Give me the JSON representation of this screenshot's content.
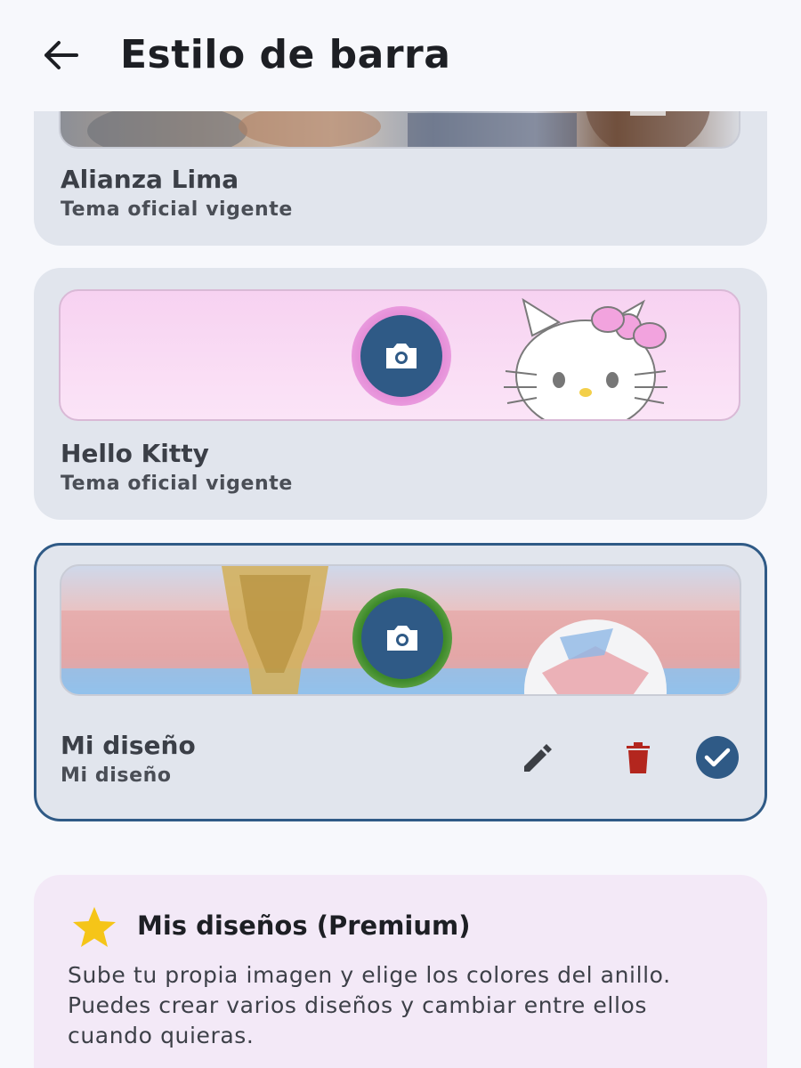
{
  "header": {
    "title": "Estilo de barra",
    "back_icon": "arrow-back-icon"
  },
  "cards": [
    {
      "name": "Alianza Lima",
      "subtitle": "Tema oficial vigente",
      "selected": false
    },
    {
      "name": "Hello Kitty",
      "subtitle": "Tema oficial vigente",
      "selected": false,
      "ring_color": "#e58fd8",
      "camera_icon": "camera-icon"
    },
    {
      "name": "Mi diseño",
      "subtitle": "Mi diseño",
      "selected": true,
      "ring_color": "#3e8a2a",
      "camera_icon": "camera-icon",
      "actions": [
        "edit-icon",
        "delete-icon",
        "check-circle-icon"
      ]
    }
  ],
  "premium": {
    "icon": "star-icon",
    "title": "Mis diseños (Premium)",
    "description_lines": [
      "Sube tu propia imagen y elige los colores del anillo.",
      "Puedes crear varios diseños y cambiar entre ellos",
      "cuando quieras."
    ]
  },
  "colors": {
    "accent": "#2f5a86",
    "delete": "#b3261e",
    "star": "#f5c518",
    "card_bg": "#e1e5ed",
    "premium_bg": "#f3e9f7"
  }
}
